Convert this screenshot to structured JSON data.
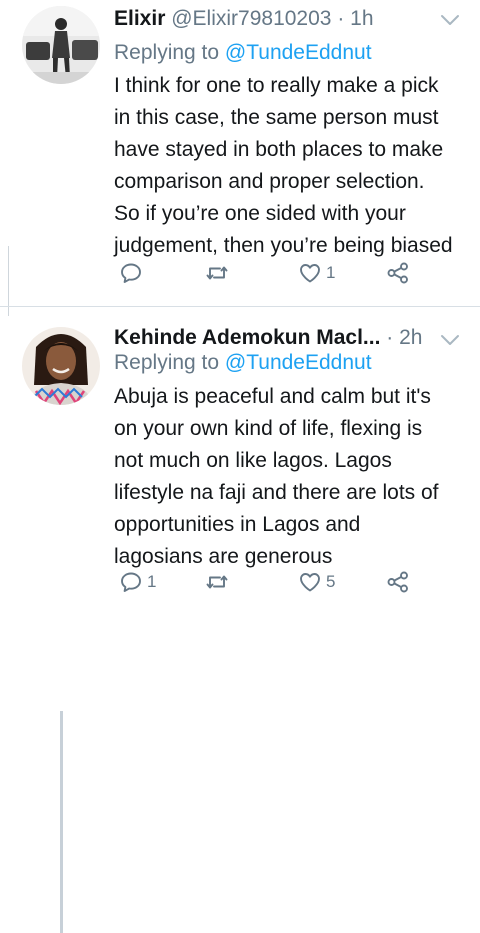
{
  "tweets": [
    {
      "name": "Elixir",
      "handle": "@Elixir79810203",
      "separator": "·",
      "time": "1h",
      "replying_prefix": "Replying to",
      "replying_to": "@TundeEddnut",
      "body_lines": [
        "I think for one to really make a pick",
        "in this case, the same person must",
        "have stayed in both places to make",
        "comparison and proper selection.",
        "So if you’re one sided with your",
        "judgement, then you’re being biased"
      ],
      "reply_count": "",
      "retweet_count": "",
      "like_count": "1"
    },
    {
      "name": "Kehinde Ademokun Macl...",
      "separator": "·",
      "time": "2h",
      "replying_prefix": "Replying to",
      "replying_to": "@TundeEddnut",
      "body_lines": [
        "Abuja is peaceful and calm but it's",
        "on your own kind of life, flexing is",
        "not much on like lagos. Lagos",
        "lifestyle na faji and there are lots of",
        "opportunities in Lagos and",
        "lagosians are generous"
      ],
      "reply_count": "1",
      "retweet_count": "",
      "like_count": "5"
    }
  ],
  "icons": {
    "reply": "reply-icon",
    "retweet": "retweet-icon",
    "like": "heart-icon",
    "share": "share-icon",
    "menu": "chevron-down-icon"
  },
  "colors": {
    "text": "#14171a",
    "secondary": "#657786",
    "link": "#1da1f2",
    "divider": "#d8dfe5"
  }
}
